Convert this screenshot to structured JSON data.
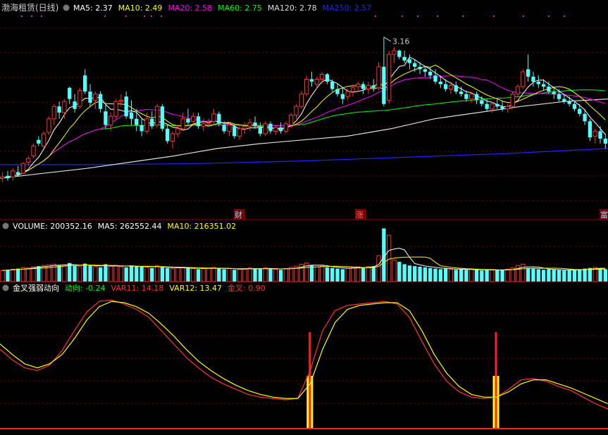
{
  "stock": {
    "title": "渤海租赁(日线)",
    "ma_labels": [
      {
        "text": "MA5: 2.37",
        "color": "#ffffff"
      },
      {
        "text": "MA10: 2.49",
        "color": "#ffff00"
      },
      {
        "text": "MA20: 2.58",
        "color": "#ff00ff"
      },
      {
        "text": "MA60: 2.75",
        "color": "#00ff00"
      },
      {
        "text": "MA120: 2.78",
        "color": "#dddddd"
      },
      {
        "text": "MA250: 2.57",
        "color": "#2222ff"
      }
    ],
    "peak_label": "3.16",
    "markers": [
      "财",
      "涨",
      "富"
    ]
  },
  "volume": {
    "labels": [
      {
        "text": "VOLUME: 200352.16",
        "color": "#ffffff"
      },
      {
        "text": "MA5: 262552.44",
        "color": "#ffffff"
      },
      {
        "text": "MA10: 216351.02",
        "color": "#ffff00"
      }
    ]
  },
  "indicator": {
    "labels": [
      {
        "text": "金叉强弱动向",
        "color": "#ffffff"
      },
      {
        "text": "动向: -0.24",
        "color": "#00ff00"
      },
      {
        "text": "VAR11: 14.18",
        "color": "#ff3333"
      },
      {
        "text": "VAR12: 13.47",
        "color": "#ffff00"
      },
      {
        "text": "金叉: 0.90",
        "color": "#ff3333"
      }
    ]
  },
  "colors": {
    "up": "#ff3232",
    "down": "#54ffff",
    "grid": "#7a0000",
    "ma5": "#ffffff",
    "ma10": "#ffff00",
    "ma20": "#ff00ff",
    "ma60": "#00ff00",
    "ma120": "#dddddd",
    "ma250": "#2222ff"
  },
  "chart_data": [
    {
      "type": "candlestick",
      "title": "渤海租赁(日线)",
      "ylim": [
        1.8,
        3.3
      ],
      "candles": [
        [
          2.02,
          2.07,
          1.99,
          2.03
        ],
        [
          2.04,
          2.08,
          2.0,
          2.02
        ],
        [
          2.03,
          2.1,
          2.0,
          2.08
        ],
        [
          2.07,
          2.12,
          2.04,
          2.05
        ],
        [
          2.06,
          2.15,
          2.05,
          2.14
        ],
        [
          2.15,
          2.2,
          2.12,
          2.18
        ],
        [
          2.2,
          2.3,
          2.18,
          2.28
        ],
        [
          2.33,
          2.36,
          2.28,
          2.3
        ],
        [
          2.28,
          2.4,
          2.26,
          2.38
        ],
        [
          2.39,
          2.52,
          2.37,
          2.5
        ],
        [
          2.5,
          2.62,
          2.45,
          2.6
        ],
        [
          2.6,
          2.64,
          2.5,
          2.55
        ],
        [
          2.55,
          2.66,
          2.5,
          2.64
        ],
        [
          2.75,
          2.76,
          2.62,
          2.66
        ],
        [
          2.64,
          2.7,
          2.55,
          2.58
        ],
        [
          2.6,
          2.75,
          2.58,
          2.73
        ],
        [
          2.85,
          2.9,
          2.7,
          2.72
        ],
        [
          2.72,
          2.78,
          2.6,
          2.63
        ],
        [
          2.65,
          2.72,
          2.58,
          2.7
        ],
        [
          2.7,
          2.72,
          2.55,
          2.58
        ],
        [
          2.56,
          2.62,
          2.42,
          2.45
        ],
        [
          2.45,
          2.55,
          2.4,
          2.52
        ],
        [
          2.52,
          2.66,
          2.5,
          2.64
        ],
        [
          2.64,
          2.7,
          2.6,
          2.65
        ],
        [
          2.68,
          2.72,
          2.5,
          2.52
        ],
        [
          2.55,
          2.65,
          2.45,
          2.5
        ],
        [
          2.5,
          2.58,
          2.4,
          2.45
        ],
        [
          2.45,
          2.5,
          2.36,
          2.4
        ],
        [
          2.4,
          2.55,
          2.38,
          2.5
        ],
        [
          2.5,
          2.56,
          2.42,
          2.44
        ],
        [
          2.45,
          2.62,
          2.43,
          2.6
        ],
        [
          2.6,
          2.62,
          2.4,
          2.42
        ],
        [
          2.42,
          2.45,
          2.3,
          2.32
        ],
        [
          2.32,
          2.4,
          2.26,
          2.38
        ],
        [
          2.38,
          2.45,
          2.35,
          2.42
        ],
        [
          2.42,
          2.55,
          2.4,
          2.5
        ],
        [
          2.5,
          2.58,
          2.45,
          2.47
        ],
        [
          2.48,
          2.55,
          2.44,
          2.52
        ],
        [
          2.52,
          2.55,
          2.42,
          2.44
        ],
        [
          2.44,
          2.5,
          2.4,
          2.46
        ],
        [
          2.47,
          2.5,
          2.44,
          2.47
        ],
        [
          2.48,
          2.58,
          2.46,
          2.54
        ],
        [
          2.54,
          2.56,
          2.44,
          2.46
        ],
        [
          2.45,
          2.48,
          2.38,
          2.4
        ],
        [
          2.4,
          2.47,
          2.36,
          2.45
        ],
        [
          2.44,
          2.46,
          2.34,
          2.36
        ],
        [
          2.36,
          2.44,
          2.33,
          2.42
        ],
        [
          2.42,
          2.47,
          2.38,
          2.44
        ],
        [
          2.44,
          2.5,
          2.4,
          2.47
        ],
        [
          2.47,
          2.52,
          2.42,
          2.44
        ],
        [
          2.43,
          2.47,
          2.36,
          2.38
        ],
        [
          2.38,
          2.48,
          2.36,
          2.46
        ],
        [
          2.46,
          2.48,
          2.38,
          2.4
        ],
        [
          2.4,
          2.45,
          2.37,
          2.43
        ],
        [
          2.43,
          2.47,
          2.38,
          2.4
        ],
        [
          2.4,
          2.48,
          2.38,
          2.46
        ],
        [
          2.45,
          2.55,
          2.43,
          2.53
        ],
        [
          2.53,
          2.62,
          2.5,
          2.6
        ],
        [
          2.6,
          2.72,
          2.58,
          2.7
        ],
        [
          2.7,
          2.85,
          2.68,
          2.82
        ],
        [
          2.82,
          2.88,
          2.76,
          2.8
        ],
        [
          2.78,
          2.84,
          2.74,
          2.82
        ],
        [
          2.82,
          2.88,
          2.78,
          2.86
        ],
        [
          2.86,
          2.87,
          2.78,
          2.8
        ],
        [
          2.8,
          2.82,
          2.72,
          2.74
        ],
        [
          2.74,
          2.78,
          2.68,
          2.7
        ],
        [
          2.7,
          2.75,
          2.62,
          2.66
        ],
        [
          2.68,
          2.74,
          2.65,
          2.72
        ],
        [
          2.72,
          2.78,
          2.68,
          2.75
        ],
        [
          2.76,
          2.8,
          2.72,
          2.78
        ],
        [
          2.78,
          2.8,
          2.7,
          2.74
        ],
        [
          2.74,
          2.8,
          2.7,
          2.77
        ],
        [
          2.77,
          2.82,
          2.72,
          2.75
        ],
        [
          2.75,
          2.96,
          2.73,
          2.92
        ],
        [
          2.92,
          3.16,
          2.6,
          2.62
        ],
        [
          2.65,
          3.05,
          2.62,
          3.02
        ],
        [
          3.02,
          3.08,
          2.95,
          3.05
        ],
        [
          3.05,
          3.06,
          2.98,
          3.0
        ],
        [
          3.0,
          3.05,
          2.95,
          2.97
        ],
        [
          2.98,
          3.02,
          2.9,
          2.95
        ],
        [
          2.95,
          2.98,
          2.88,
          2.92
        ],
        [
          2.92,
          2.96,
          2.86,
          2.9
        ],
        [
          2.9,
          2.92,
          2.84,
          2.88
        ],
        [
          2.88,
          2.92,
          2.82,
          2.85
        ],
        [
          2.85,
          2.9,
          2.78,
          2.8
        ],
        [
          2.8,
          2.85,
          2.75,
          2.78
        ],
        [
          2.78,
          2.82,
          2.72,
          2.74
        ],
        [
          2.74,
          2.8,
          2.7,
          2.77
        ],
        [
          2.77,
          2.8,
          2.7,
          2.72
        ],
        [
          2.72,
          2.76,
          2.68,
          2.7
        ],
        [
          2.7,
          2.73,
          2.64,
          2.66
        ],
        [
          2.66,
          2.72,
          2.63,
          2.7
        ],
        [
          2.7,
          2.72,
          2.62,
          2.65
        ],
        [
          2.65,
          2.68,
          2.6,
          2.62
        ],
        [
          2.62,
          2.66,
          2.56,
          2.58
        ],
        [
          2.58,
          2.64,
          2.55,
          2.62
        ],
        [
          2.62,
          2.66,
          2.58,
          2.6
        ],
        [
          2.6,
          2.64,
          2.56,
          2.58
        ],
        [
          2.58,
          2.62,
          2.55,
          2.6
        ],
        [
          2.6,
          2.72,
          2.58,
          2.7
        ],
        [
          2.7,
          2.78,
          2.68,
          2.76
        ],
        [
          2.76,
          2.9,
          2.74,
          2.88
        ],
        [
          2.9,
          3.02,
          2.8,
          2.84
        ],
        [
          2.84,
          2.88,
          2.76,
          2.8
        ],
        [
          2.8,
          2.85,
          2.75,
          2.78
        ],
        [
          2.78,
          2.82,
          2.73,
          2.76
        ],
        [
          2.76,
          2.8,
          2.7,
          2.72
        ],
        [
          2.72,
          2.76,
          2.66,
          2.7
        ],
        [
          2.7,
          2.74,
          2.64,
          2.66
        ],
        [
          2.66,
          2.7,
          2.62,
          2.64
        ],
        [
          2.64,
          2.68,
          2.6,
          2.62
        ],
        [
          2.62,
          2.65,
          2.56,
          2.58
        ],
        [
          2.58,
          2.62,
          2.52,
          2.54
        ],
        [
          2.54,
          2.58,
          2.45,
          2.48
        ],
        [
          2.48,
          2.5,
          2.32,
          2.35
        ],
        [
          2.36,
          2.42,
          2.3,
          2.4
        ],
        [
          2.4,
          2.44,
          2.3,
          2.34
        ],
        [
          2.34,
          2.38,
          2.26,
          2.3
        ]
      ],
      "ma250": [
        2.13,
        2.13,
        2.14,
        2.16,
        2.19,
        2.22,
        2.26
      ],
      "ma120": [
        2.02,
        2.06,
        2.1,
        2.15,
        2.2,
        2.26,
        2.3,
        2.33,
        2.36,
        2.42,
        2.5,
        2.55,
        2.6,
        2.64,
        2.66
      ]
    },
    {
      "type": "bar",
      "title": "VOLUME",
      "ylim": [
        0,
        900000
      ],
      "values": [
        180000,
        190000,
        200000,
        210000,
        230000,
        220000,
        240000,
        250000,
        260000,
        270000,
        280000,
        260000,
        270000,
        300000,
        250000,
        240000,
        290000,
        260000,
        240000,
        230000,
        280000,
        250000,
        260000,
        240000,
        230000,
        260000,
        250000,
        240000,
        230000,
        220000,
        260000,
        230000,
        220000,
        210000,
        220000,
        230000,
        220000,
        210000,
        200000,
        210000,
        220000,
        230000,
        210000,
        200000,
        210000,
        190000,
        200000,
        210000,
        220000,
        210000,
        200000,
        220000,
        210000,
        200000,
        190000,
        210000,
        230000,
        250000,
        280000,
        300000,
        260000,
        240000,
        250000,
        230000,
        220000,
        210000,
        200000,
        220000,
        230000,
        240000,
        230000,
        240000,
        250000,
        420000,
        860000,
        750000,
        350000,
        320000,
        280000,
        260000,
        250000,
        240000,
        230000,
        220000,
        210000,
        200000,
        210000,
        200000,
        190000,
        200000,
        190000,
        200000,
        190000,
        180000,
        190000,
        185000,
        180000,
        190000,
        200000,
        220000,
        260000,
        280000,
        220000,
        210000,
        200000,
        190000,
        195000,
        190000,
        185000,
        180000,
        190000,
        185000,
        200000,
        210000,
        220000,
        230000,
        215000,
        200352
      ]
    },
    {
      "type": "line",
      "title": "金叉强弱动向",
      "ylim": [
        0,
        100
      ],
      "series": [
        {
          "name": "VAR11",
          "values": [
            56,
            48,
            42,
            40,
            44,
            55,
            70,
            84,
            92,
            93,
            90,
            86,
            80,
            70,
            60,
            50,
            42,
            35,
            30,
            26,
            22,
            20,
            19,
            18,
            19,
            40,
            70,
            85,
            89,
            90,
            91,
            92,
            90,
            80,
            62,
            45,
            32,
            24,
            20,
            19,
            20,
            26,
            33,
            34,
            32,
            28,
            25,
            20,
            15,
            11
          ]
        },
        {
          "name": "VAR12",
          "values": [
            60,
            52,
            45,
            42,
            45,
            52,
            64,
            78,
            88,
            92,
            91,
            88,
            83,
            75,
            66,
            56,
            47,
            40,
            34,
            29,
            25,
            22,
            20,
            19,
            19,
            30,
            56,
            76,
            86,
            89,
            90,
            91,
            91,
            85,
            70,
            52,
            38,
            28,
            22,
            20,
            20,
            24,
            30,
            33,
            33,
            30,
            27,
            23,
            19,
            15
          ]
        }
      ],
      "golden_cross_signals": [
        25,
        40
      ]
    }
  ]
}
